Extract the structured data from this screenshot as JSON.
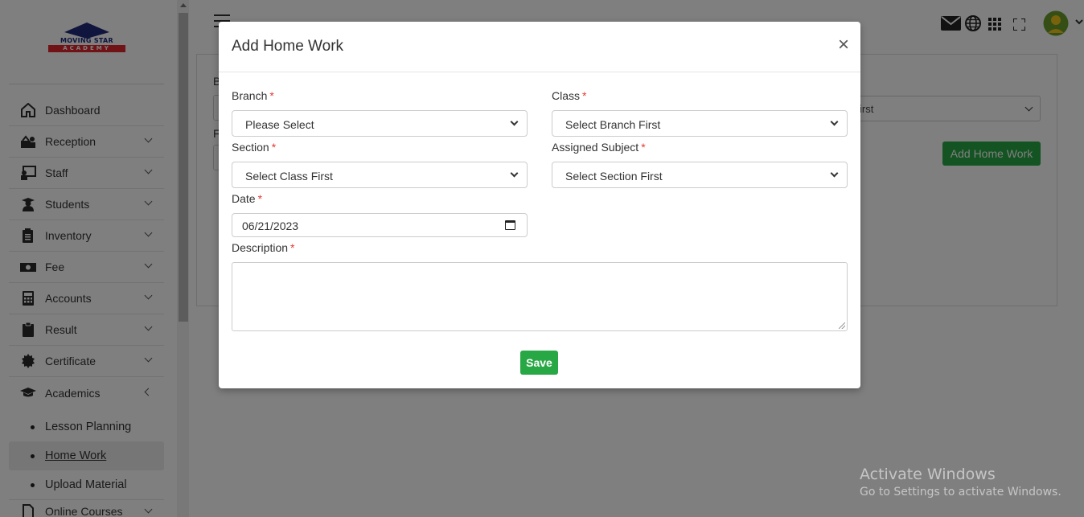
{
  "app": {
    "logo_line1": "MOVING STAR",
    "logo_line2": "ACADEMY"
  },
  "sidebar": {
    "items": [
      {
        "label": "Dashboard",
        "icon": "home-icon",
        "expandable": false
      },
      {
        "label": "Reception",
        "icon": "reception-icon",
        "expandable": true
      },
      {
        "label": "Staff",
        "icon": "staff-icon",
        "expandable": true
      },
      {
        "label": "Students",
        "icon": "students-icon",
        "expandable": true
      },
      {
        "label": "Inventory",
        "icon": "inventory-icon",
        "expandable": true
      },
      {
        "label": "Fee",
        "icon": "fee-icon",
        "expandable": true
      },
      {
        "label": "Accounts",
        "icon": "calculator-icon",
        "expandable": true
      },
      {
        "label": "Result",
        "icon": "clipboard-icon",
        "expandable": true
      },
      {
        "label": "Certificate",
        "icon": "certificate-icon",
        "expandable": true
      },
      {
        "label": "Academics",
        "icon": "graduation-cap-icon",
        "expandable": true,
        "expanded": true
      }
    ],
    "academics_sub": [
      {
        "label": "Lesson Planning",
        "active": false
      },
      {
        "label": "Home Work",
        "active": true
      },
      {
        "label": "Upload Material",
        "active": false
      }
    ],
    "last_item": {
      "label": "Online Courses",
      "icon": "file-icon"
    }
  },
  "topbar": {
    "icons": [
      "mail-icon",
      "globe-icon",
      "grid-icon",
      "fullscreen-icon",
      "user-avatar-icon"
    ]
  },
  "background": {
    "select_text": "irst",
    "add_button": "Add Home Work",
    "label_b": "B",
    "label_f": "F"
  },
  "modal": {
    "title": "Add Home Work",
    "close": "×",
    "fields": {
      "branch": {
        "label": "Branch",
        "value": "Please Select"
      },
      "class": {
        "label": "Class",
        "value": "Select Branch First"
      },
      "section": {
        "label": "Section",
        "value": "Select Class First"
      },
      "subject": {
        "label": "Assigned Subject",
        "value": "Select Section First"
      },
      "date": {
        "label": "Date",
        "value": "06/21/2023"
      },
      "description": {
        "label": "Description",
        "value": ""
      }
    },
    "required_mark": "*",
    "save_label": "Save"
  },
  "watermark": {
    "line1": "Activate Windows",
    "line2": "Go to Settings to activate Windows."
  },
  "colors": {
    "primary_green": "#28a745",
    "required_red": "#e53935",
    "brand_blue": "#1f2a7a",
    "brand_red": "#e3262d"
  }
}
